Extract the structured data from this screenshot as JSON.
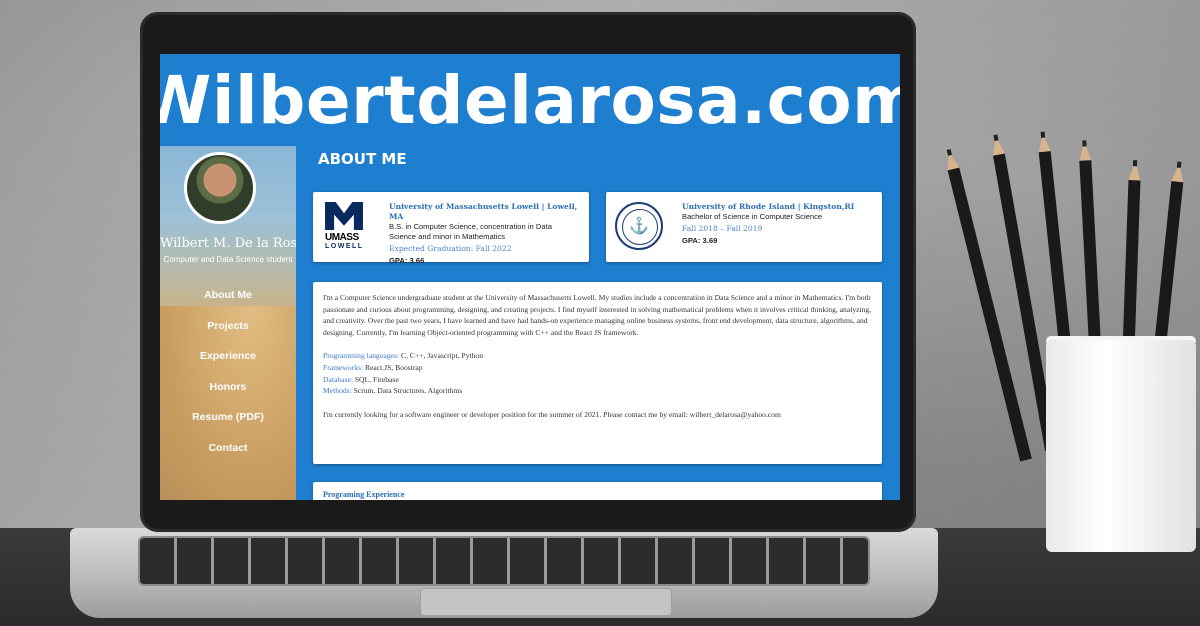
{
  "banner": {
    "title": "Wilbertdelarosa.com"
  },
  "sidebar": {
    "name": "Wilbert M. De la Rosa",
    "subtitle": "Computer and Data Science student",
    "nav": [
      "About Me",
      "Projects",
      "Experience",
      "Honors",
      "Resume (PDF)",
      "Contact"
    ]
  },
  "main": {
    "section_title": "ABOUT ME",
    "education": [
      {
        "logo": "umass-lowell-logo",
        "logo_text": "UMASS",
        "logo_subtext": "LOWELL",
        "school": "University of Massachusetts Lowell | Lowell, MA",
        "degree": "B.S. in Computer Science, concentration in Data Science and minor in Mathematics",
        "date": "Expected Graduation: Fall 2022",
        "gpa": "GPA: 3.66"
      },
      {
        "logo": "uri-seal-logo",
        "school": "University of Rhode Island | Kingston,RI",
        "degree": "Bachelor of Science in Computer Science",
        "date": "Fall 2018 – Fall 2019",
        "gpa": "GPA: 3.69"
      }
    ],
    "bio": {
      "intro": "I'm a Computer Science undergraduate student at the University of Massachusetts Lowell. My studies include a concentration in Data Science and a minor in Mathematics. I'm both passionate and curious about programming, designing, and creating projects. I find myself interested in solving mathematical problems when it involves critical thinking, analyzing, and creativity. Over the past two years, I have learned and have had hands-on experience managing online business systems, front end development, data structure, algorithms, and designing. Currently, I'm learning Object-oriented programming with C++ and the React JS framework.",
      "skills": [
        {
          "label": "Programming languages:",
          "value": " C, C++, Javascript, Python"
        },
        {
          "label": "Frameworks:",
          "value": " React.JS, Boostrap"
        },
        {
          "label": "Database:",
          "value": " SQL, Firebase"
        },
        {
          "label": "Methods:",
          "value": " Scrum, Data Structures, Algorithms"
        }
      ],
      "closing": "I'm currently looking for a software engineer or developer position for the summer of 2021. Please contact me by email: wilbert_delarosa@yahoo.com"
    },
    "next_section": "Programing Experience"
  }
}
